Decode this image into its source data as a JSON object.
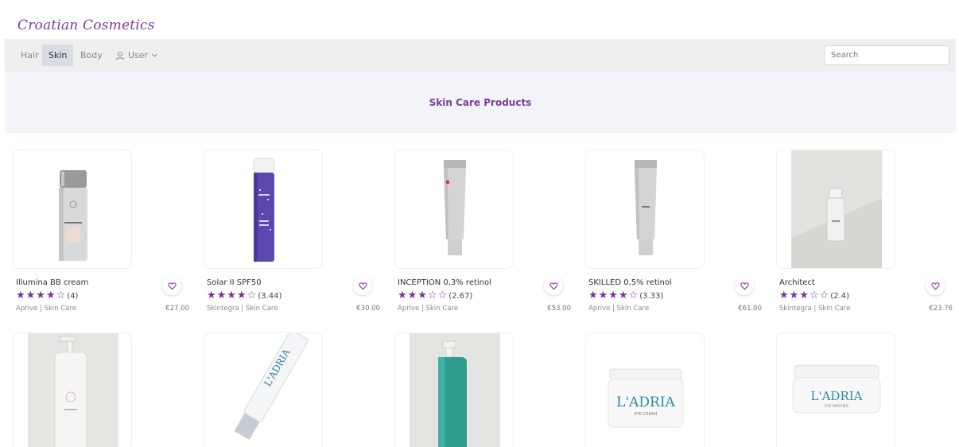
{
  "brand": "Croatian Cosmetics",
  "nav": {
    "items": [
      "Hair",
      "Skin",
      "Body"
    ],
    "user_label": "User",
    "search_placeholder": "Search"
  },
  "hero": {
    "title": "Skin Care Products"
  },
  "products": [
    {
      "name": "Illumina BB cream",
      "rating_text": "(4)",
      "stars": 4,
      "brand_category": "Aprive | Skin Care",
      "price": "€27.00"
    },
    {
      "name": "Solar II SPF50",
      "rating_text": "(3.44)",
      "stars": 4,
      "brand_category": "Skintegra | Skin Care",
      "price": "€30.00"
    },
    {
      "name": "INCEPTION 0,3% retinol",
      "rating_text": "(2.67)",
      "stars": 3,
      "brand_category": "Aprive | Skin Care",
      "price": "€53.00"
    },
    {
      "name": "SKILLED 0,5% retinol",
      "rating_text": "(3.33)",
      "stars": 4,
      "brand_category": "Aprive | Skin Care",
      "price": "€61.00"
    },
    {
      "name": "Architect",
      "rating_text": "(2.4)",
      "stars": 3,
      "brand_category": "Skintegra | Skin Care",
      "price": "€23.76"
    }
  ],
  "second_row": [
    {
      "image": "pump-bottle-white"
    },
    {
      "image": "tube-ladria",
      "label": "L'ADRIA"
    },
    {
      "image": "pump-bottle-teal"
    },
    {
      "image": "jar-ladria",
      "label": "L'ADRIA",
      "sub": "EYE CREAM"
    },
    {
      "image": "jar-ladria",
      "label": "L'ADRIA",
      "sub": "EYE PATCHES"
    }
  ],
  "icons": {
    "user": "user-icon",
    "chevron": "chevron-down-icon",
    "heart": "heart-icon",
    "star": "star-icon"
  },
  "colors": {
    "accent": "#7b3b9c",
    "star": "#7b2d9d"
  }
}
